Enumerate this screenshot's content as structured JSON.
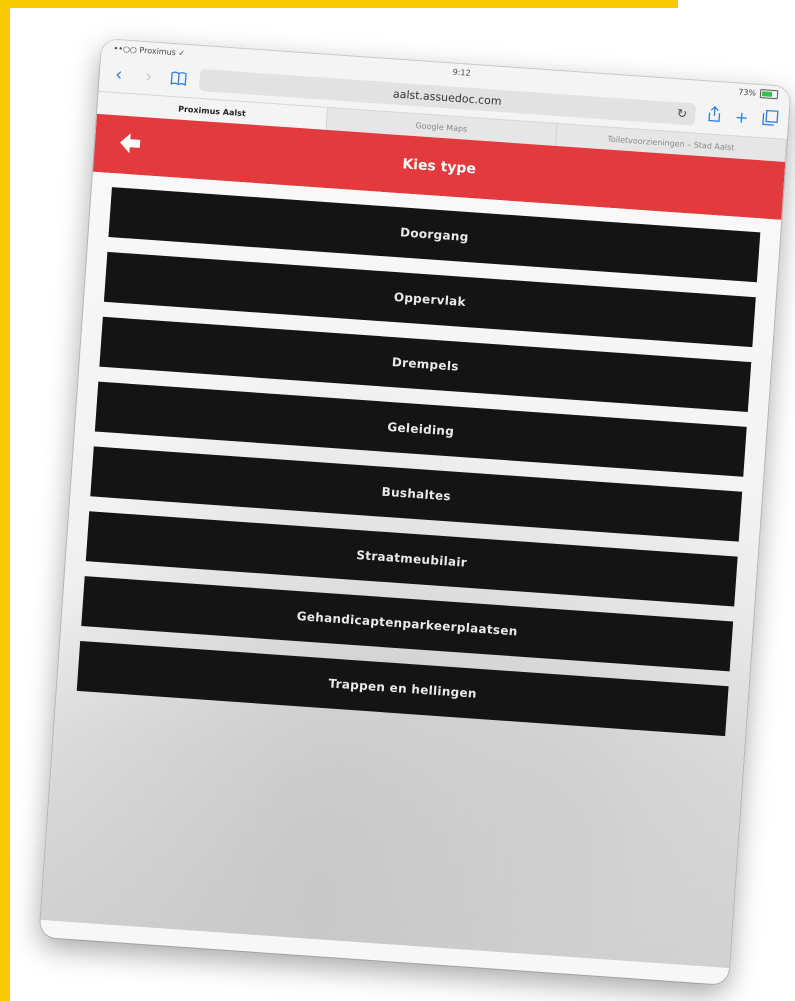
{
  "browser": {
    "status_left": "••○○ Proximus ✓",
    "status_time": "9:12",
    "status_battery": "73%",
    "url": "aalst.assuedoc.com",
    "reload_icon": "reload-icon",
    "tabs": [
      {
        "label": "Proximus Aalst"
      },
      {
        "label": "Google Maps"
      },
      {
        "label": "Toiletvoorzieningen – Stad Aalst"
      }
    ]
  },
  "header": {
    "title": "Kies type",
    "back_icon": "back-arrow-icon",
    "color": "#e23a3d"
  },
  "types": [
    {
      "label": "Doorgang"
    },
    {
      "label": "Oppervlak"
    },
    {
      "label": "Drempels"
    },
    {
      "label": "Geleiding"
    },
    {
      "label": "Bushaltes"
    },
    {
      "label": "Straatmeubilair"
    },
    {
      "label": "Gehandicaptenparkeerplaatsen"
    },
    {
      "label": "Trappen en hellingen"
    }
  ]
}
